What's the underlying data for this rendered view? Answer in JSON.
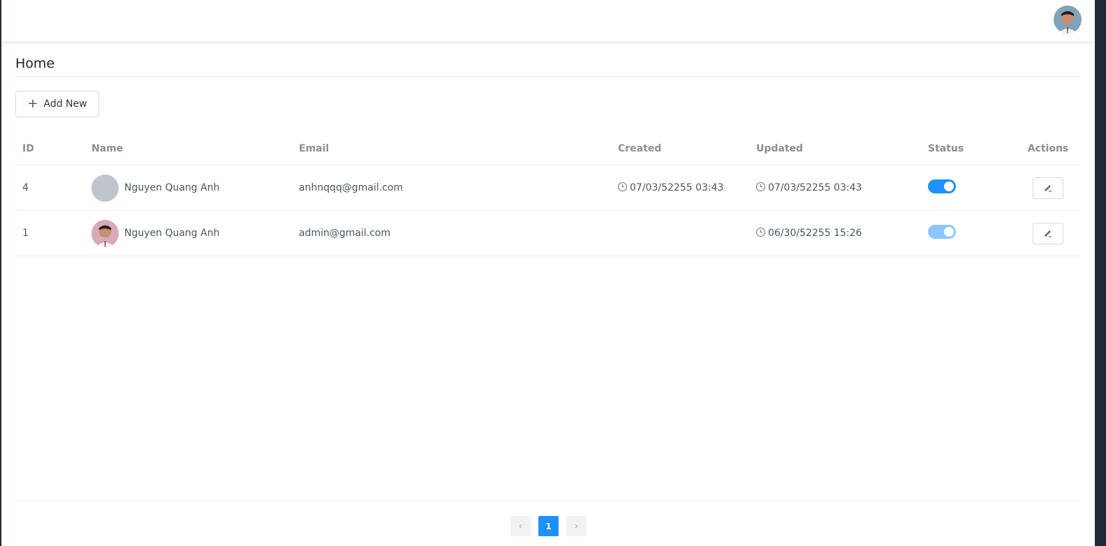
{
  "header": {
    "avatar_alt": "user avatar"
  },
  "page": {
    "title": "Home"
  },
  "toolbar": {
    "add_label": "Add New"
  },
  "table": {
    "columns": [
      "ID",
      "Name",
      "Email",
      "Created",
      "Updated",
      "Status",
      "Actions"
    ],
    "rows": [
      {
        "id": "4",
        "name": "Nguyen Quang Anh",
        "email": "anhnqqq@gmail.com",
        "created": "07/03/52255 03:43",
        "updated": "07/03/52255 03:43",
        "status": "on",
        "avatar": "placeholder"
      },
      {
        "id": "1",
        "name": "Nguyen Quang Anh",
        "email": "admin@gmail.com",
        "created": "",
        "updated": "06/30/52255 15:26",
        "status": "on-disabled",
        "avatar": "photo"
      }
    ]
  },
  "pagination": {
    "current": "1",
    "prev": "‹",
    "next": "›"
  },
  "colors": {
    "primary": "#1e90ff",
    "primary_light": "#8cc6ff"
  }
}
